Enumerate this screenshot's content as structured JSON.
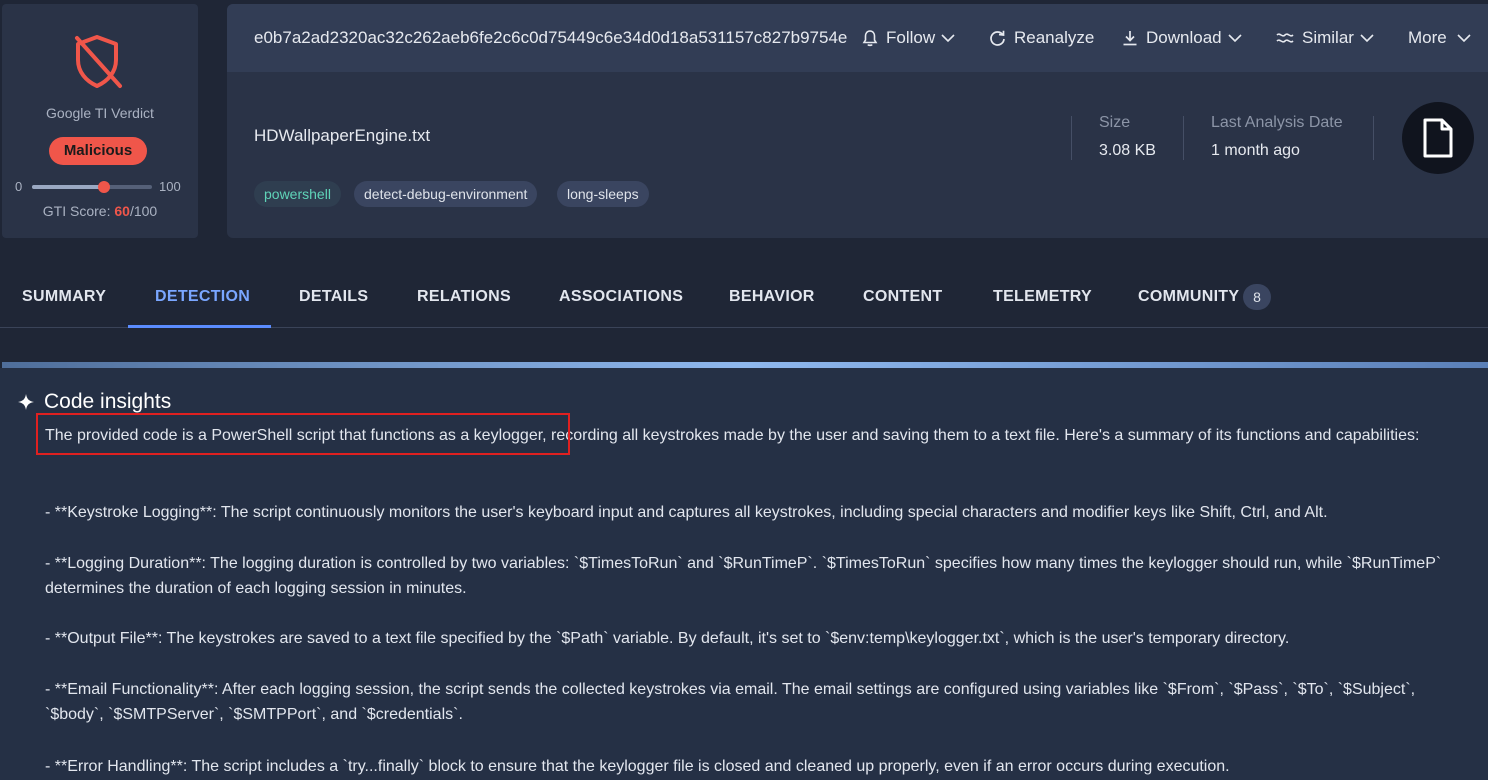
{
  "verdict": {
    "label": "Google TI Verdict",
    "badge": "Malicious",
    "slider_min": "0",
    "slider_max": "100",
    "score_value": 60,
    "score_prefix": "GTI Score: ",
    "score_text": "60",
    "score_suffix": "/100"
  },
  "toolbar": {
    "hash": "e0b7a2ad2320ac32c262aeb6fe2c6c0d75449c6e34d0d18a531157c827b9754e",
    "follow": "Follow",
    "reanalyze": "Reanalyze",
    "download": "Download",
    "similar": "Similar",
    "more": "More"
  },
  "file": {
    "name": "HDWallpaperEngine.txt",
    "tags": [
      "powershell",
      "detect-debug-environment",
      "long-sleeps"
    ],
    "size_label": "Size",
    "size_value": "3.08 KB",
    "date_label": "Last Analysis Date",
    "date_value": "1 month ago"
  },
  "tabs": [
    {
      "label": "SUMMARY"
    },
    {
      "label": "DETECTION"
    },
    {
      "label": "DETAILS"
    },
    {
      "label": "RELATIONS"
    },
    {
      "label": "ASSOCIATIONS"
    },
    {
      "label": "BEHAVIOR"
    },
    {
      "label": "CONTENT"
    },
    {
      "label": "TELEMETRY"
    },
    {
      "label": "COMMUNITY"
    }
  ],
  "community_count": "8",
  "insights": {
    "title": "Code insights",
    "paragraphs": [
      "The provided code is a PowerShell script that functions as a keylogger, recording all keystrokes made by the user and saving them to a text file. Here's a summary of its functions and capabilities:",
      "- **Keystroke Logging**: The script continuously monitors the user's keyboard input and captures all keystrokes, including special characters and modifier keys like Shift, Ctrl, and Alt.",
      "- **Logging Duration**: The logging duration is controlled by two variables: `$TimesToRun` and `$RunTimeP`. `$TimesToRun` specifies how many times the keylogger should run, while `$RunTimeP` determines the duration of each logging session in minutes.",
      "- **Output File**: The keystrokes are saved to a text file specified by the `$Path` variable. By default, it's set to `$env:temp\\keylogger.txt`, which is the user's temporary directory.",
      "- **Email Functionality**: After each logging session, the script sends the collected keystrokes via email. The email settings are configured using variables like `$From`, `$Pass`, `$To`, `$Subject`, `$body`, `$SMTPServer`, `$SMTPPort`, and `$credentials`.",
      "- **Error Handling**: The script includes a `try...finally` block to ensure that the keylogger file is closed and cleaned up properly, even if an error occurs during execution."
    ]
  },
  "colors": {
    "malicious": "#f0564a",
    "accent": "#5b8cff",
    "background": "#1f2636",
    "card": "#2a3347"
  }
}
